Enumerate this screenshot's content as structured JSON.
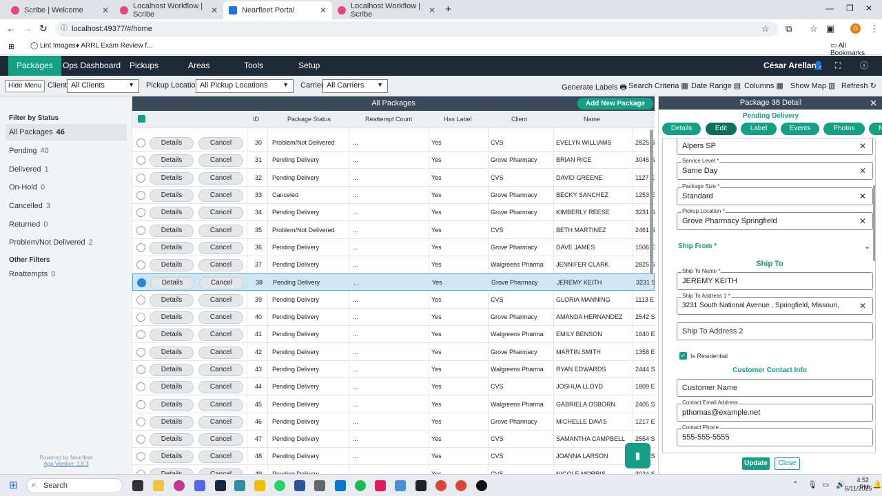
{
  "browser": {
    "tabs": [
      {
        "title": "Scribe | Welcome",
        "color": "#e8457a"
      },
      {
        "title": "Localhost Workflow | Scribe",
        "color": "#e8457a"
      },
      {
        "title": "Nearfleet Portal",
        "color": "#1a73e8",
        "active": true
      },
      {
        "title": "Localhost Workflow | Scribe",
        "color": "#e8457a"
      }
    ],
    "url": "localhost:49377/#/home",
    "bookmarks": [
      "Lint Images",
      "ARRL Exam Review f..."
    ],
    "all_bookmarks": "All Bookmarks",
    "profile_initial": "G"
  },
  "nav": {
    "items": [
      "Packages",
      "Ops Dashboard",
      "Pickups",
      "Areas",
      "Tools",
      "Setup"
    ],
    "user": "César Arellano",
    "accent": "#13a085"
  },
  "filters": {
    "hide_menu": "Hide Menu",
    "client_label": "Client",
    "client_value": "All Clients",
    "pickup_label": "Pickup Location",
    "pickup_value": "All Pickup Locations",
    "carrier_label": "Carrier",
    "carrier_value": "All Carriers",
    "tools": [
      "Generate Labels",
      "Search Criteria",
      "Date Range",
      "Columns",
      "Show Map",
      "Refresh"
    ]
  },
  "sidebar": {
    "title": "Filter by Status",
    "statuses": [
      {
        "label": "All Packages",
        "count": "46"
      },
      {
        "label": "Pending",
        "count": "40"
      },
      {
        "label": "Delivered",
        "count": "1"
      },
      {
        "label": "On-Hold",
        "count": "0"
      },
      {
        "label": "Cancelled",
        "count": "3"
      },
      {
        "label": "Returned",
        "count": "0"
      },
      {
        "label": "Problem/Not Delivered",
        "count": "2"
      }
    ],
    "other_title": "Other Filters",
    "other": [
      {
        "label": "Reattempts",
        "count": "0"
      }
    ],
    "powered": "Powered by Nearfleet",
    "version": "App Version: 1.9.3"
  },
  "table": {
    "title": "All Packages",
    "add_button": "Add New Package",
    "columns": [
      "ID",
      "Package Status",
      "Reattempt Count",
      "Has Label",
      "Client",
      "Name"
    ],
    "details_label": "Details",
    "cancel_label": "Cancel",
    "rows": [
      {
        "id": "30",
        "status": "Problem/Not Delivered",
        "re": "...",
        "label": "Yes",
        "client": "CVS",
        "name": "EVELYN WILLIAMS",
        "addr": "2825 S"
      },
      {
        "id": "31",
        "status": "Pending Delivery",
        "re": "...",
        "label": "Yes",
        "client": "Grove Pharmacy",
        "name": "BRIAN RICE",
        "addr": "3046 S"
      },
      {
        "id": "32",
        "status": "Pending Delivery",
        "re": "...",
        "label": "Yes",
        "client": "CVS",
        "name": "DAVID GREENE",
        "addr": "1127 E"
      },
      {
        "id": "33",
        "status": "Canceled",
        "re": "...",
        "label": "Yes",
        "client": "Grove Pharmacy",
        "name": "BECKY SANCHEZ",
        "addr": "1253 E"
      },
      {
        "id": "34",
        "status": "Pending Delivery",
        "re": "...",
        "label": "Yes",
        "client": "Grove Pharmacy",
        "name": "KIMBERLY REESE",
        "addr": "3231 S"
      },
      {
        "id": "35",
        "status": "Problem/Not Delivered",
        "re": "...",
        "label": "Yes",
        "client": "CVS",
        "name": "BETH MARTINEZ",
        "addr": "2461 S"
      },
      {
        "id": "36",
        "status": "Pending Delivery",
        "re": "...",
        "label": "Yes",
        "client": "Grove Pharmacy",
        "name": "DAVE JAMES",
        "addr": "1506 E"
      },
      {
        "id": "37",
        "status": "Pending Delivery",
        "re": "...",
        "label": "Yes",
        "client": "Walgreens Pharma",
        "name": "JENNIFER CLARK",
        "addr": "2825 S"
      },
      {
        "id": "38",
        "status": "Pending Delivery",
        "re": "...",
        "label": "Yes",
        "client": "Grove Pharmacy",
        "name": "JEREMY KEITH",
        "addr": "3231 S",
        "selected": true
      },
      {
        "id": "39",
        "status": "Pending Delivery",
        "re": "...",
        "label": "Yes",
        "client": "CVS",
        "name": "GLORIA MANNING",
        "addr": "1113 E"
      },
      {
        "id": "40",
        "status": "Pending Delivery",
        "re": "...",
        "label": "Yes",
        "client": "Grove Pharmacy",
        "name": "AMANDA HERNANDEZ",
        "addr": "2542 S"
      },
      {
        "id": "41",
        "status": "Pending Delivery",
        "re": "...",
        "label": "Yes",
        "client": "Walgreens Pharma",
        "name": "EMILY BENSON",
        "addr": "1640 E"
      },
      {
        "id": "42",
        "status": "Pending Delivery",
        "re": "...",
        "label": "Yes",
        "client": "Grove Pharmacy",
        "name": "MARTIN SMITH",
        "addr": "1358 E"
      },
      {
        "id": "43",
        "status": "Pending Delivery",
        "re": "...",
        "label": "Yes",
        "client": "Walgreens Pharma",
        "name": "RYAN EDWARDS",
        "addr": "2444 S"
      },
      {
        "id": "44",
        "status": "Pending Delivery",
        "re": "...",
        "label": "Yes",
        "client": "CVS",
        "name": "JOSHUA LLOYD",
        "addr": "1809 E"
      },
      {
        "id": "45",
        "status": "Pending Delivery",
        "re": "...",
        "label": "Yes",
        "client": "Walgreens Pharma",
        "name": "GABRIELA OSBORN",
        "addr": "2405 S"
      },
      {
        "id": "46",
        "status": "Pending Delivery",
        "re": "...",
        "label": "Yes",
        "client": "Grove Pharmacy",
        "name": "MICHELLE DAVIS",
        "addr": "1217 E"
      },
      {
        "id": "47",
        "status": "Pending Delivery",
        "re": "...",
        "label": "Yes",
        "client": "CVS",
        "name": "SAMANTHA CAMPBELL",
        "addr": "2554 S"
      },
      {
        "id": "48",
        "status": "Pending Delivery",
        "re": "...",
        "label": "Yes",
        "client": "CVS",
        "name": "JOANNA LARSON",
        "addr": "3024 S"
      },
      {
        "id": "49",
        "status": "Pending Delivery",
        "re": "...",
        "label": "Yes",
        "client": "CVS",
        "name": "NICOLE MORRIS",
        "addr": "3024 S"
      }
    ]
  },
  "detail": {
    "title": "Package 38 Detail",
    "status": "Pending Delivery",
    "tabs": [
      "Details",
      "Edit",
      "Label",
      "Events",
      "Photos",
      "N"
    ],
    "carrier_value": "Alpers SP",
    "service_level_label": "Service Level *",
    "service_level": "Same Day",
    "package_size_label": "Package Size *",
    "package_size": "Standard",
    "pickup_location_label": "Pickup Location *",
    "pickup_location": "Grove Pharmacy Springfield",
    "ship_from": "Ship From *",
    "ship_to": "Ship To",
    "ship_to_name_label": "Ship To Name *",
    "ship_to_name": "JEREMY KEITH",
    "ship_to_addr1_label": "Ship To Address 1 *",
    "ship_to_addr1": "3231 South National Avenue , Springfield, Missouri,",
    "ship_to_addr2_ph": "Ship To Address 2",
    "residential": "Is Residential",
    "contact_head": "Customer Contact Info",
    "customer_name_ph": "Customer Name",
    "email_label": "Contact Email Address",
    "email": "pthomas@example.net",
    "phone_label": "Contact Phone",
    "phone": "555-555-5555",
    "update": "Update",
    "close": "Close"
  },
  "taskbar": {
    "search": "Search",
    "time": "4:52 PM",
    "date": "6/11/2025"
  }
}
